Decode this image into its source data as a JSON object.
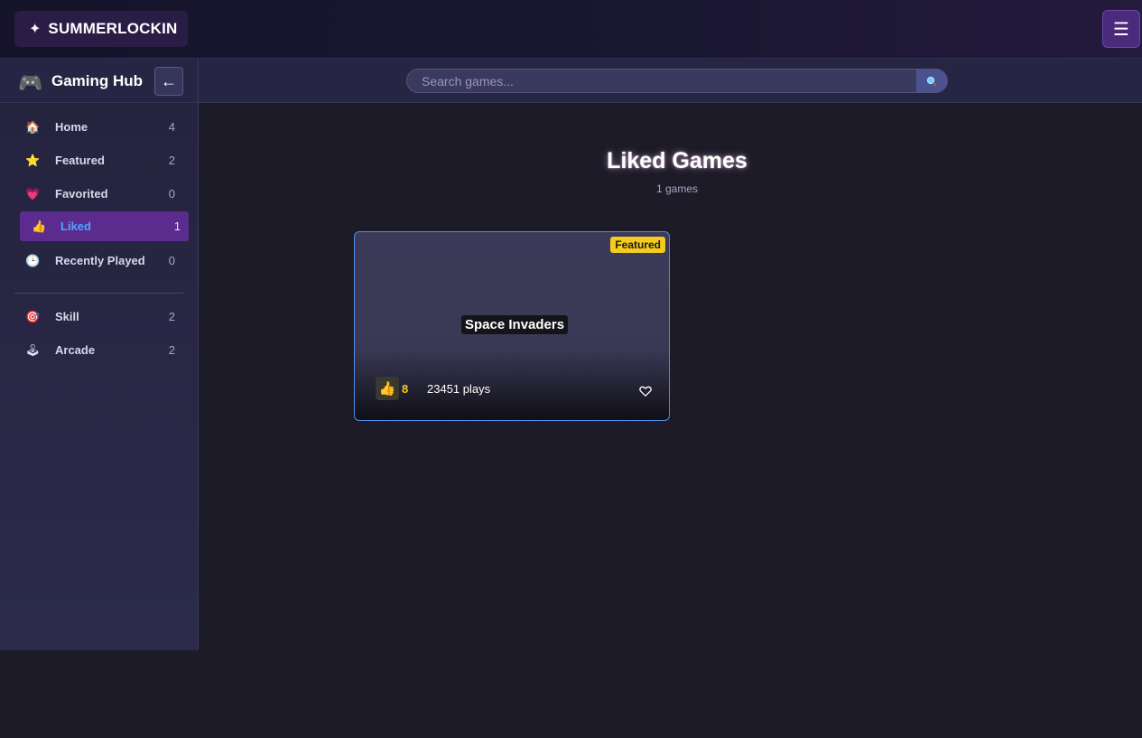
{
  "brand": {
    "logo_icon": "sparkle-icon",
    "name": "SUMMERLOCKIN"
  },
  "topbar": {
    "menu_icon": "hamburger-icon",
    "menu_glyph": "☰"
  },
  "hub": {
    "icon": "gamepad-icon",
    "title": "Gaming Hub",
    "collapse_glyph": "←"
  },
  "search": {
    "placeholder": "Search games...",
    "icon": "search-icon"
  },
  "sidebar": {
    "items": [
      {
        "icon": "house-icon",
        "glyph": "🏠",
        "label": "Home",
        "count": "4"
      },
      {
        "icon": "star-icon",
        "glyph": "⭐",
        "label": "Featured",
        "count": "2"
      },
      {
        "icon": "heart-icon",
        "glyph": "💗",
        "label": "Favorited",
        "count": "0"
      },
      {
        "icon": "thumbs-up-icon",
        "glyph": "👍",
        "label": "Liked",
        "count": "1",
        "active": true
      },
      {
        "icon": "clock-icon",
        "glyph": "🕒",
        "label": "Recently Played",
        "count": "0"
      }
    ],
    "categories": [
      {
        "icon": "target-icon",
        "glyph": "🎯",
        "label": "Skill",
        "count": "2"
      },
      {
        "icon": "joystick-icon",
        "glyph": "🕹",
        "label": "Arcade",
        "count": "2"
      }
    ]
  },
  "main": {
    "title": "Liked Games",
    "count_text": "1 games",
    "games": [
      {
        "title": "Space Invaders",
        "badge": "Featured",
        "likes": "8",
        "plays": "23451 plays"
      }
    ]
  },
  "colors": {
    "accent_purple": "#5b2c8e",
    "active_text": "#4fa3ff",
    "featured_yellow": "#f5cc1c",
    "card_border": "#4d8ee6"
  }
}
